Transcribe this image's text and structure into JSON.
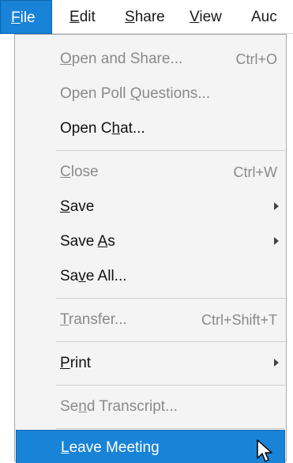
{
  "menubar": {
    "items": [
      {
        "u": "F",
        "rest": "ile"
      },
      {
        "u": "E",
        "rest": "dit"
      },
      {
        "u": "S",
        "rest": "hare"
      },
      {
        "u": "V",
        "rest": "iew"
      },
      {
        "u": "",
        "rest": "Auc"
      }
    ]
  },
  "file_menu": {
    "open_and_share": {
      "pre": "",
      "u": "O",
      "post": "pen and Share...",
      "shortcut": "Ctrl+O"
    },
    "open_poll_questions": {
      "pre": "Open Poll ",
      "u": "Q",
      "post": "uestions..."
    },
    "open_chat": {
      "pre": "Open C",
      "u": "h",
      "post": "at..."
    },
    "close": {
      "pre": "",
      "u": "C",
      "post": "lose",
      "shortcut": "Ctrl+W"
    },
    "save": {
      "pre": "",
      "u": "S",
      "post": "ave"
    },
    "save_as": {
      "pre": "Save ",
      "u": "A",
      "post": "s"
    },
    "save_all": {
      "pre": "Sa",
      "u": "v",
      "post": "e All..."
    },
    "transfer": {
      "pre": "",
      "u": "T",
      "post": "ransfer...",
      "shortcut": "Ctrl+Shift+T"
    },
    "print": {
      "pre": "",
      "u": "P",
      "post": "rint"
    },
    "send_transcript": {
      "pre": "Se",
      "u": "n",
      "post": "d Transcript..."
    },
    "leave_meeting": {
      "pre": "",
      "u": "L",
      "post": "eave Meeting"
    }
  },
  "icons": {
    "submenu": "chevron-right-icon",
    "pointer": "mouse-pointer-icon"
  },
  "colors": {
    "highlight": "#1883d7",
    "highlight_border": "#0b67b2",
    "disabled_text": "#8a8a8a",
    "menu_background": "#f4f4f4"
  }
}
